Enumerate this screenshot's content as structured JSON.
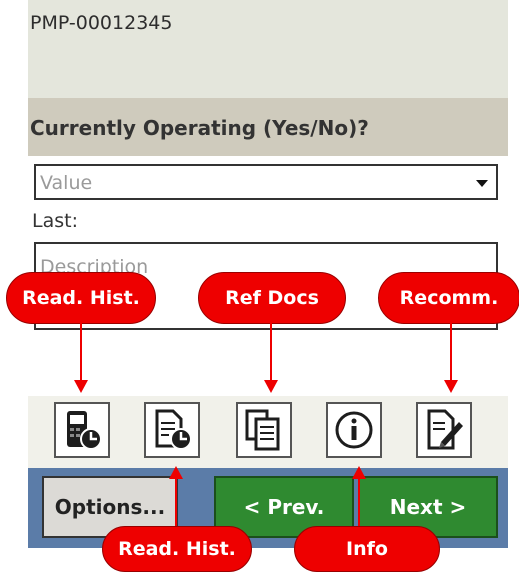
{
  "asset_id": "PMP-00012345",
  "question": "Currently Operating (Yes/No)?",
  "value_field": {
    "placeholder": "Value"
  },
  "last_label": "Last:",
  "description_field": {
    "placeholder": "Description"
  },
  "toolbar_icons": [
    "device-history-icon",
    "document-history-icon",
    "reference-docs-icon",
    "info-icon",
    "recommendation-icon"
  ],
  "buttons": {
    "options": "Options...",
    "prev": "< Prev.",
    "next": "Next >"
  },
  "callouts": {
    "read_hist_top": "Read. Hist.",
    "ref_docs": "Ref Docs",
    "recomm": "Recomm.",
    "read_hist_bottom": "Read. Hist.",
    "info": "Info"
  },
  "colors": {
    "callout": "#ee0000",
    "nav_green": "#2f8a30",
    "bottom_bar": "#5b7ca8"
  }
}
